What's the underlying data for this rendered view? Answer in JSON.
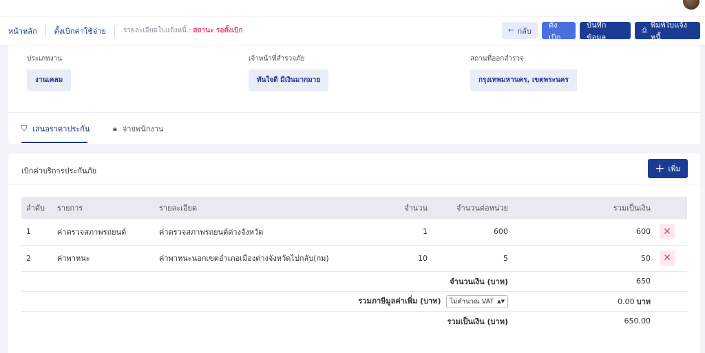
{
  "breadcrumb": {
    "home": "หน้าหลัก",
    "section": "ตั้งเบิกค่าใช้จ่าย",
    "detail": "รายละเอียดใบแจ้งหนี้ :",
    "status": "สถานะ รอตั้งเบิก"
  },
  "header_buttons": {
    "back": "กลับ",
    "set": "ตั้งเบิก",
    "save": "บันทึกข้อมูล",
    "print": "พิมพ์ใบแจ้งหนี้"
  },
  "info": {
    "job_type": {
      "label": "ประเภทงาน",
      "value": "งานเคลม"
    },
    "surveyor": {
      "label": "เจ้าหน้าที่สำรวจภัย",
      "value": "ทันใจดี มีเงินมากมาย"
    },
    "location": {
      "label": "สถานที่ออกสำรวจ",
      "value": "กรุงเทพมหานคร, เขตพระนคร"
    }
  },
  "tabs": [
    {
      "label": "เสนอราคาประกัน",
      "icon": "shield-icon"
    },
    {
      "label": "จ่ายพนักงาน",
      "icon": "lock-icon"
    }
  ],
  "section": {
    "title": "เบิกค่าบริการประกันภัย",
    "add_label": "เพิ่ม"
  },
  "table": {
    "headers": [
      "ลำดับ",
      "รายการ",
      "รายละเอียด",
      "จำนวน",
      "จำนวนต่อหน่วย",
      "รวมเป็นเงิน"
    ],
    "rows": [
      {
        "no": "1",
        "item": "ค่าตรวจสภาพรถยนต์",
        "desc": "ค่าตรวจสภาพรถยนต์ต่างจังหวัด",
        "qty": "1",
        "unit": "600",
        "total": "600"
      },
      {
        "no": "2",
        "item": "ค่าพาหนะ",
        "desc": "ค่าพาหนะนอกเขตอำเภอเมืองต่างจังหวัดไปกลับ(กม)",
        "qty": "10",
        "unit": "5",
        "total": "50"
      }
    ]
  },
  "summary": {
    "subtotal_label": "จำนวนเงิน (บาท)",
    "subtotal_value": "650",
    "vat_label": "รวมภาษีมูลค่าเพิ่ม (บาท)",
    "vat_option": "ไม่คำนวณ VAT",
    "vat_value": "0.00",
    "vat_unit": "บาท",
    "grand_label": "รวมเป็นเงิน (บาท)",
    "grand_value": "650.00"
  },
  "colors": {
    "primary": "#1a3c93",
    "accent": "#4a6fe0",
    "status": "#e0457b"
  }
}
